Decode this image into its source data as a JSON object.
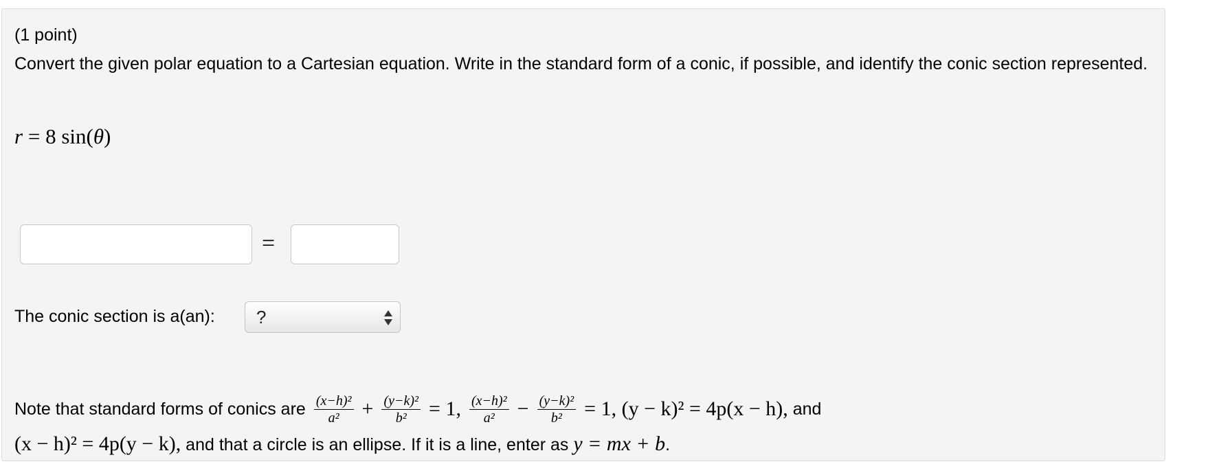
{
  "problem": {
    "points_label": "(1 point)",
    "instructions": "Convert the given polar equation to a Cartesian equation. Write in the standard form of a conic, if possible, and identify the conic section represented.",
    "equation": {
      "lhs": "r",
      "eq": " = ",
      "rhs": "8 sin(",
      "var": "θ",
      "close": ")"
    }
  },
  "answer": {
    "left_value": "",
    "equals": "=",
    "right_value": ""
  },
  "conic": {
    "label": "The conic section is a(an): ",
    "selected": "?"
  },
  "note": {
    "intro": "Note that standard forms of conics are",
    "frac1_num": "(x−h)²",
    "frac1_den": "a²",
    "plus": "+",
    "frac2_num": "(y−k)²",
    "frac2_den": "b²",
    "eq_one_a": "= 1,",
    "frac3_num": "(x−h)²",
    "frac3_den": "a²",
    "minus": "−",
    "frac4_num": "(y−k)²",
    "frac4_den": "b²",
    "eq_one_b": "= 1, (y − k)² = 4p(x − h),",
    "and": " and",
    "line2_math": "(x − h)² = 4p(y − k),",
    "line2_text": " and that a circle is an ellipse. If it is a line, enter as ",
    "line_math": "y = mx + b",
    "period": "."
  }
}
